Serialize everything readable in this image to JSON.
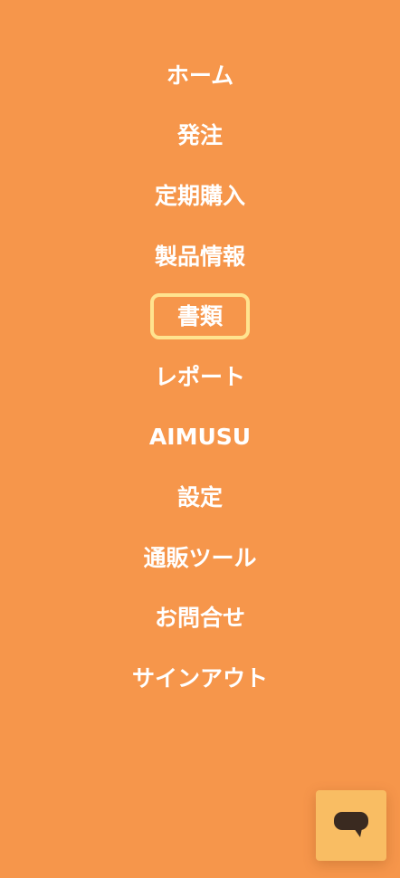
{
  "nav": {
    "items": [
      {
        "label": "ホーム"
      },
      {
        "label": "発注"
      },
      {
        "label": "定期購入"
      },
      {
        "label": "製品情報"
      },
      {
        "label": "書類",
        "focused": true
      },
      {
        "label": "レポート"
      },
      {
        "label": "AIMUSU"
      },
      {
        "label": "設定"
      },
      {
        "label": "通販ツール"
      },
      {
        "label": "お問合せ"
      },
      {
        "label": "サインアウト"
      }
    ]
  },
  "chat": {
    "icon": "chat-bubble-icon"
  },
  "colors": {
    "background": "#f6964b",
    "text": "#ffffff",
    "focus_ring": "#ffe38f",
    "chat_button": "#f9bd63",
    "chat_icon": "#3a2a20"
  }
}
